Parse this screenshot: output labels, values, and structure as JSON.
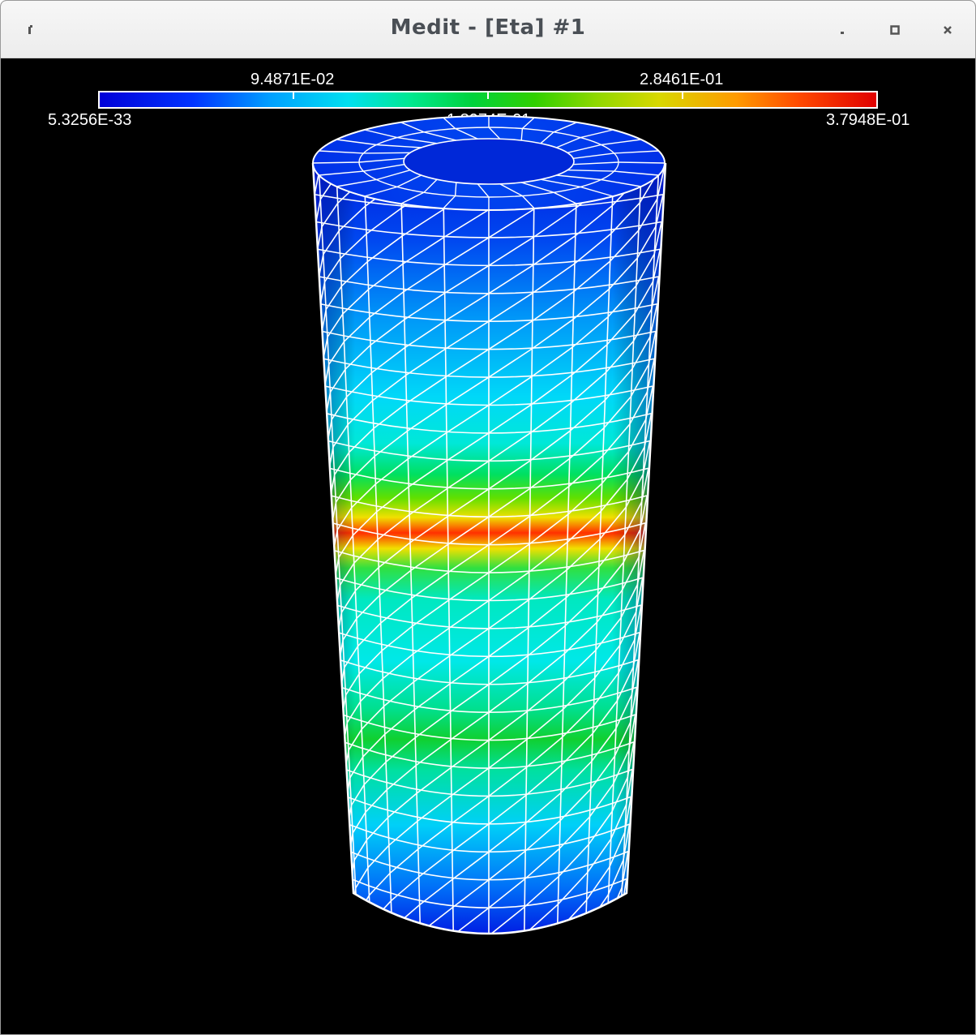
{
  "window": {
    "title": "Medit - [Eta] #1"
  },
  "icons": {
    "menu": "window-menu-icon",
    "minimize": "minimize-icon",
    "maximize": "maximize-icon",
    "close": "close-icon"
  },
  "colorbar": {
    "top_labels": [
      "9.4871E-02",
      "2.8461E-01"
    ],
    "bottom_labels": {
      "min": "5.3256E-33",
      "mid": "1.8974E-01",
      "max": "3.7948E-01"
    },
    "gradient_colors": [
      "#0000d8",
      "#00a0ff",
      "#00e0f0",
      "#00d23c",
      "#d8d800",
      "#ff4a00",
      "#e00000"
    ]
  },
  "viewport": {
    "background": "#000000",
    "mesh_color": "#ffffff",
    "object": "cylinder-mesh"
  }
}
